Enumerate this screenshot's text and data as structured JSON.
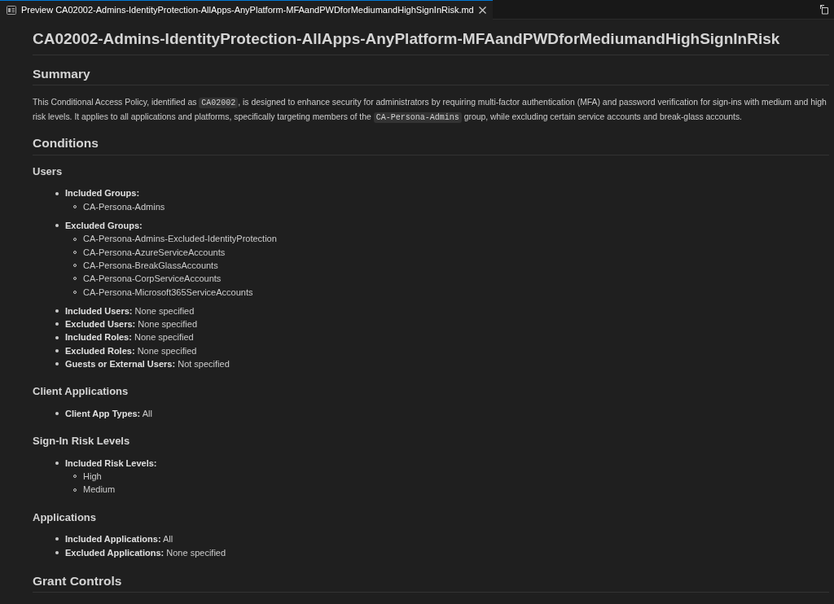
{
  "tab": {
    "title": "Preview CA02002-Admins-IdentityProtection-AllApps-AnyPlatform-MFAandPWDforMediumandHighSignInRisk.md",
    "selected": true
  },
  "document": {
    "title": "CA02002-Admins-IdentityProtection-AllApps-AnyPlatform-MFAandPWDforMediumandHighSignInRisk",
    "blocks": [
      {
        "kind": "h2",
        "text": "Summary"
      },
      {
        "kind": "paragraph",
        "parts": [
          {
            "kind": "text",
            "text": "This Conditional Access Policy, identified as "
          },
          {
            "kind": "code",
            "text": "CA02002"
          },
          {
            "kind": "text",
            "text": ", is designed to enhance security for administrators by requiring multi-factor authentication (MFA) and password verification for sign-ins with medium and high risk levels. It applies to all applications and platforms, specifically targeting members of the "
          },
          {
            "kind": "code",
            "text": "CA-Persona-Admins"
          },
          {
            "kind": "text",
            "text": " group, while excluding certain service accounts and break-glass accounts."
          }
        ]
      },
      {
        "kind": "h2",
        "text": "Conditions"
      },
      {
        "kind": "h3",
        "text": "Users"
      },
      {
        "kind": "list",
        "items": [
          {
            "label": "Included Groups:",
            "children": [
              "CA-Persona-Admins"
            ]
          },
          {
            "label": "Excluded Groups:",
            "children": [
              "CA-Persona-Admins-Excluded-IdentityProtection",
              "CA-Persona-AzureServiceAccounts",
              "CA-Persona-BreakGlassAccounts",
              "CA-Persona-CorpServiceAccounts",
              "CA-Persona-Microsoft365ServiceAccounts"
            ]
          },
          {
            "label": "Included Users:",
            "value": "None specified"
          },
          {
            "label": "Excluded Users:",
            "value": "None specified"
          },
          {
            "label": "Included Roles:",
            "value": "None specified"
          },
          {
            "label": "Excluded Roles:",
            "value": "None specified"
          },
          {
            "label": "Guests or External Users:",
            "value": "Not specified"
          }
        ]
      },
      {
        "kind": "h3",
        "text": "Client Applications"
      },
      {
        "kind": "list",
        "items": [
          {
            "label": "Client App Types:",
            "value": "All"
          }
        ]
      },
      {
        "kind": "h3",
        "text": "Sign-In Risk Levels"
      },
      {
        "kind": "list",
        "items": [
          {
            "label": "Included Risk Levels:",
            "children": [
              "High",
              "Medium"
            ]
          }
        ]
      },
      {
        "kind": "h3",
        "text": "Applications"
      },
      {
        "kind": "list",
        "items": [
          {
            "label": "Included Applications:",
            "value": "All"
          },
          {
            "label": "Excluded Applications:",
            "value": "None specified"
          }
        ]
      },
      {
        "kind": "h2",
        "text": "Grant Controls"
      }
    ]
  }
}
